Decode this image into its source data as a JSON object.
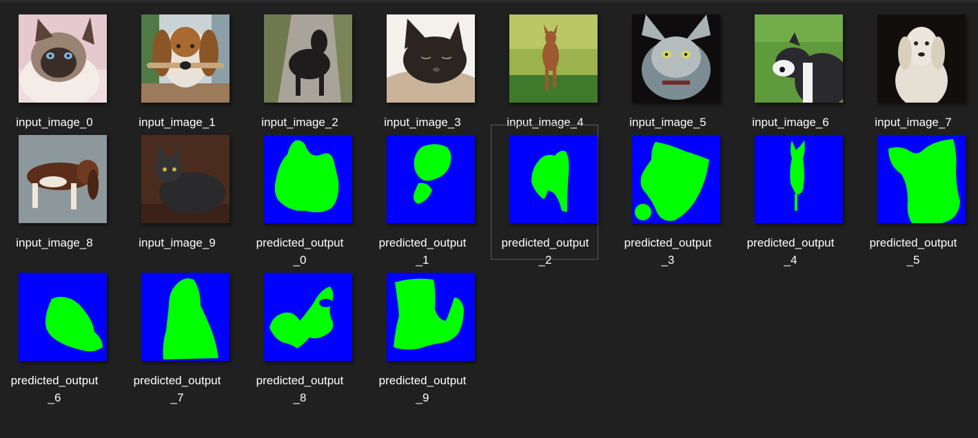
{
  "gallery": {
    "files": [
      {
        "name": "input_image_0",
        "thumbnail": "photo-cat-siamese",
        "selected": false
      },
      {
        "name": "input_image_1",
        "thumbnail": "photo-dog-beagle",
        "selected": false
      },
      {
        "name": "input_image_2",
        "thumbnail": "photo-dog-black-path",
        "selected": false
      },
      {
        "name": "input_image_3",
        "thumbnail": "photo-cat-sleeping",
        "selected": false
      },
      {
        "name": "input_image_4",
        "thumbnail": "photo-dog-running-grass",
        "selected": false
      },
      {
        "name": "input_image_5",
        "thumbnail": "photo-cat-sphynx",
        "selected": false
      },
      {
        "name": "input_image_6",
        "thumbnail": "photo-dog-pitbull-grass",
        "selected": false
      },
      {
        "name": "input_image_7",
        "thumbnail": "photo-dog-white-dark-bg",
        "selected": false
      },
      {
        "name": "input_image_8",
        "thumbnail": "photo-dog-basset",
        "selected": false
      },
      {
        "name": "input_image_9",
        "thumbnail": "photo-cat-grey",
        "selected": false
      },
      {
        "name": "predicted_output\n_0",
        "thumbnail": "segmentation-mask",
        "selected": false
      },
      {
        "name": "predicted_output\n_1",
        "thumbnail": "segmentation-mask",
        "selected": false
      },
      {
        "name": "predicted_output\n_2",
        "thumbnail": "segmentation-mask",
        "selected": true
      },
      {
        "name": "predicted_output\n_3",
        "thumbnail": "segmentation-mask",
        "selected": false
      },
      {
        "name": "predicted_output\n_4",
        "thumbnail": "segmentation-mask",
        "selected": false
      },
      {
        "name": "predicted_output\n_5",
        "thumbnail": "segmentation-mask",
        "selected": false
      },
      {
        "name": "predicted_output\n_6",
        "thumbnail": "segmentation-mask",
        "selected": false
      },
      {
        "name": "predicted_output\n_7",
        "thumbnail": "segmentation-mask",
        "selected": false
      },
      {
        "name": "predicted_output\n_8",
        "thumbnail": "segmentation-mask",
        "selected": false
      },
      {
        "name": "predicted_output\n_9",
        "thumbnail": "segmentation-mask",
        "selected": false
      }
    ]
  },
  "colors": {
    "background": "#202020",
    "mask_background": "#0000ff",
    "mask_foreground": "#00ff00",
    "selection_border": "#5b5b5b",
    "label_text": "#ffffff"
  }
}
